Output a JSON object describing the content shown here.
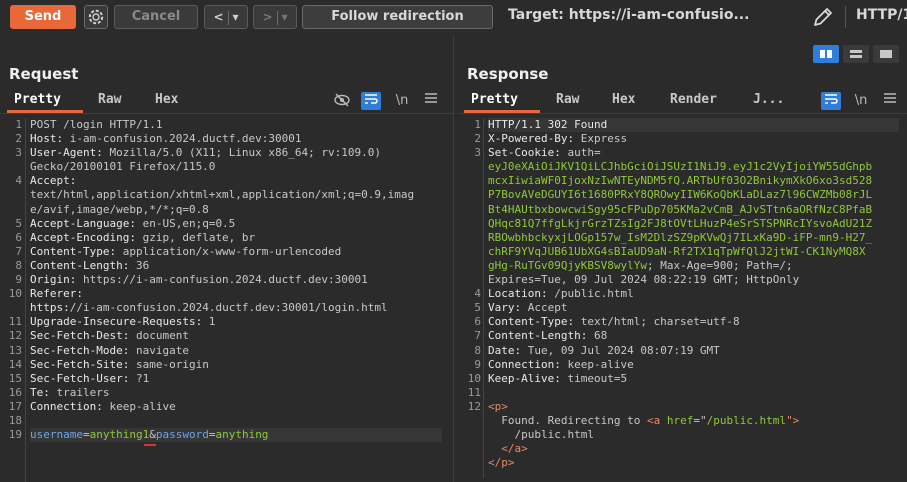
{
  "toolbar": {
    "send_label": "Send",
    "cancel_label": "Cancel",
    "back_label": "<",
    "forward_label": ">",
    "dropdown_glyph": "▾",
    "follow_label": "Follow redirection",
    "target_text": "Target: https://i-am-confusio...",
    "protocol_text": "HTTP/1"
  },
  "request": {
    "title": "Request",
    "tabs": [
      {
        "label": "Pretty"
      },
      {
        "label": "Raw"
      },
      {
        "label": "Hex"
      }
    ],
    "newline_label": "\\n",
    "line_numbers": [
      "1",
      "2",
      "3",
      "",
      "4",
      "",
      "",
      "5",
      "6",
      "7",
      "8",
      "9",
      "10",
      "",
      "11",
      "12",
      "13",
      "14",
      "15",
      "16",
      "17",
      "18",
      "19"
    ],
    "lines": [
      "POST /login HTTP/1.1",
      "Host: i-am-confusion.2024.ductf.dev:30001",
      "User-Agent: Mozilla/5.0 (X11; Linux x86_64; rv:109.0)",
      "Gecko/20100101 Firefox/115.0",
      "Accept:",
      "text/html,application/xhtml+xml,application/xml;q=0.9,imag",
      "e/avif,image/webp,*/*;q=0.8",
      "Accept-Language: en-US,en;q=0.5",
      "Accept-Encoding: gzip, deflate, br",
      "Content-Type: application/x-www-form-urlencoded",
      "Content-Length: 36",
      "Origin: https://i-am-confusion.2024.ductf.dev:30001",
      "Referer:",
      "https://i-am-confusion.2024.ductf.dev:30001/login.html",
      "Upgrade-Insecure-Requests: 1",
      "Sec-Fetch-Dest: document",
      "Sec-Fetch-Mode: navigate",
      "Sec-Fetch-Site: same-origin",
      "Sec-Fetch-User: ?1",
      "Te: trailers",
      "Connection: keep-alive",
      "",
      "username=anything1&password=anything"
    ]
  },
  "response": {
    "title": "Response",
    "tabs": [
      {
        "label": "Pretty"
      },
      {
        "label": "Raw"
      },
      {
        "label": "Hex"
      },
      {
        "label": "Render"
      },
      {
        "label": "J..."
      }
    ],
    "newline_label": "\\n",
    "line_numbers": [
      "1",
      "2",
      "3",
      "",
      "",
      "",
      "",
      "",
      "",
      "",
      "",
      "",
      "4",
      "5",
      "6",
      "7",
      "8",
      "9",
      "10",
      "11",
      "12",
      "",
      "",
      "",
      ""
    ],
    "lines": [
      "HTTP/1.1 302 Found",
      "X-Powered-By: Express",
      "Set-Cookie: auth=",
      "eyJ0eXAiOiJKV1QiLCJhbGciOiJSUzI1NiJ9.eyJ1c2VyIjoiYW55dGhpb",
      "mcxIiwiaWF0IjoxNzIwNTEyNDM5fQ.ARTbUf03O2BnikymXkO6xo3sd528",
      "P7BovAVeDGUYI6t1680PRxY8QROwyIIW6KoQbKLaDLaz7l96CWZMb08rJL",
      "Bt4HAUtbxbowcwiSgy95cFPuDp705KMa2vCmB_AJvSTtn6aORfNzC8PfaB",
      "QHqc81Q7ffgLkjrGrzTZsIg2FJ8tOVtLHuzP4eSrSTSPNRcIYsvoAdU21Z",
      "RBOwbhbckyxjLOGp157w_IsM2DlzSZ9pKVwQj7ILxKa9D-iFP-mn9-H27_",
      "chRF9YVqJUB61UbXG4sBIaUD9aN-Rf2TX1qTpWfQlJ2jtWI-CK1NyMQ8X",
      "gHg-RuTGv09QjyKBSV8wylYw; Max-Age=900; Path=/;",
      "Expires=Tue, 09 Jul 2024 08:22:19 GMT; HttpOnly",
      "Location: /public.html",
      "Vary: Accept",
      "Content-Type: text/html; charset=utf-8",
      "Content-Length: 68",
      "Date: Tue, 09 Jul 2024 08:07:19 GMT",
      "Connection: keep-alive",
      "Keep-Alive: timeout=5",
      "",
      "<p>",
      "  Found. Redirecting to <a href=\"/public.html\">",
      "    /public.html",
      "  </a>",
      "</p>"
    ]
  }
}
